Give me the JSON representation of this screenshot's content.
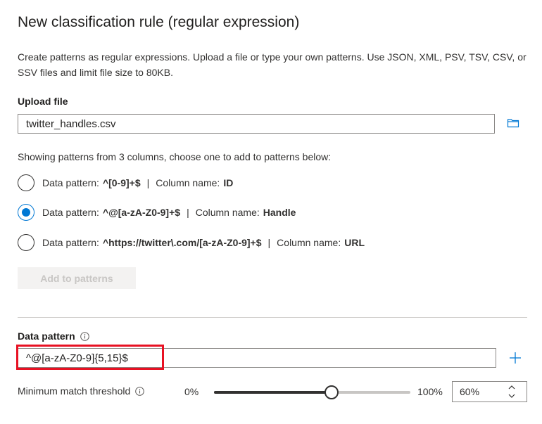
{
  "title": "New classification rule (regular expression)",
  "description": "Create patterns as regular expressions. Upload a file or type your own patterns. Use JSON, XML, PSV, TSV, CSV, or SSV files and limit file size to 80KB.",
  "upload": {
    "label": "Upload file",
    "value": "twitter_handles.csv"
  },
  "showing_text": "Showing patterns from 3 columns, choose one to add to patterns below:",
  "options": [
    {
      "prefix": "Data pattern:",
      "pattern": "^[0-9]+$",
      "separator": "|",
      "column_prefix": "Column name:",
      "column": "ID",
      "checked": false
    },
    {
      "prefix": "Data pattern:",
      "pattern": "^@[a-zA-Z0-9]+$",
      "separator": "|",
      "column_prefix": "Column name:",
      "column": "Handle",
      "checked": true
    },
    {
      "prefix": "Data pattern:",
      "pattern": "^https://twitter\\.com/[a-zA-Z0-9]+$",
      "separator": "|",
      "column_prefix": "Column name:",
      "column": "URL",
      "checked": false
    }
  ],
  "add_button": "Add to patterns",
  "data_pattern": {
    "label": "Data pattern",
    "value": "^@[a-zA-Z0-9]{5,15}$"
  },
  "threshold": {
    "label": "Minimum match threshold",
    "min_label": "0%",
    "max_label": "100%",
    "value_percent": 60,
    "spin_value": "60%"
  },
  "colors": {
    "accent": "#0078d4",
    "highlight": "#e81123"
  },
  "icons": {
    "browse": "folder-icon",
    "info": "info-icon",
    "add": "plus-icon",
    "spin_up": "chevron-up-icon",
    "spin_down": "chevron-down-icon"
  }
}
